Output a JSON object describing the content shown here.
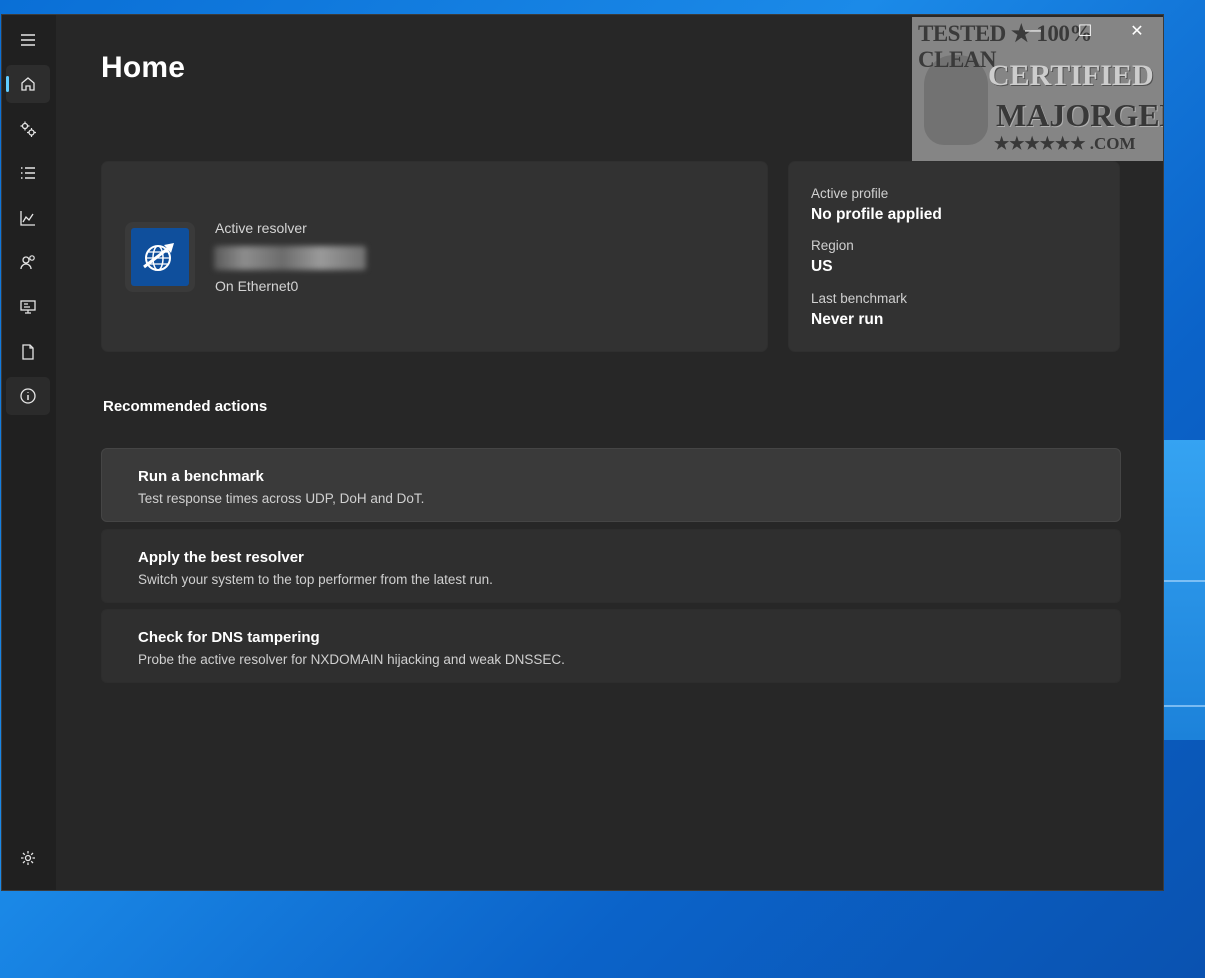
{
  "page": {
    "title": "Home"
  },
  "window_controls": {
    "minimize": "—",
    "maximize": "☐",
    "close": "✕"
  },
  "sidebar": {
    "items": [
      {
        "name": "menu",
        "icon": "hamburger-icon"
      },
      {
        "name": "home",
        "icon": "home-icon",
        "active": true
      },
      {
        "name": "configure",
        "icon": "gears-icon"
      },
      {
        "name": "resolvers",
        "icon": "list-icon"
      },
      {
        "name": "benchmark",
        "icon": "chart-icon"
      },
      {
        "name": "profiles",
        "icon": "users-icon"
      },
      {
        "name": "network",
        "icon": "monitor-network-icon"
      },
      {
        "name": "logs",
        "icon": "document-icon"
      },
      {
        "name": "about",
        "icon": "info-icon"
      }
    ],
    "footer": {
      "name": "settings",
      "icon": "settings-gear-icon"
    }
  },
  "resolver_card": {
    "label": "Active resolver",
    "value_redacted": true,
    "interface": "On Ethernet0"
  },
  "profile_card": {
    "active_profile_label": "Active profile",
    "active_profile_value": "No profile applied",
    "region_label": "Region",
    "region_value": "US",
    "benchmark_label": "Last benchmark",
    "benchmark_value": "Never run"
  },
  "recommended": {
    "title": "Recommended actions",
    "actions": [
      {
        "title": "Run a benchmark",
        "desc": "Test response times across UDP, DoH and DoT."
      },
      {
        "title": "Apply the best resolver",
        "desc": "Switch your system to the top performer from the latest run."
      },
      {
        "title": "Check for DNS tampering",
        "desc": "Probe the active resolver for NXDOMAIN hijacking and weak DNSSEC."
      }
    ]
  },
  "watermark": {
    "line1": "TESTED ★ 100% CLEAN",
    "line2": "CERTIFIED",
    "line3": "MAJORGEEKS",
    "line4": "★★★★★★ .COM"
  },
  "colors": {
    "accent": "#60cdff",
    "window_bg": "#272727",
    "sidebar_bg": "#202020",
    "card_bg": "#323232",
    "desktop_blue": "#0a6fd6"
  }
}
